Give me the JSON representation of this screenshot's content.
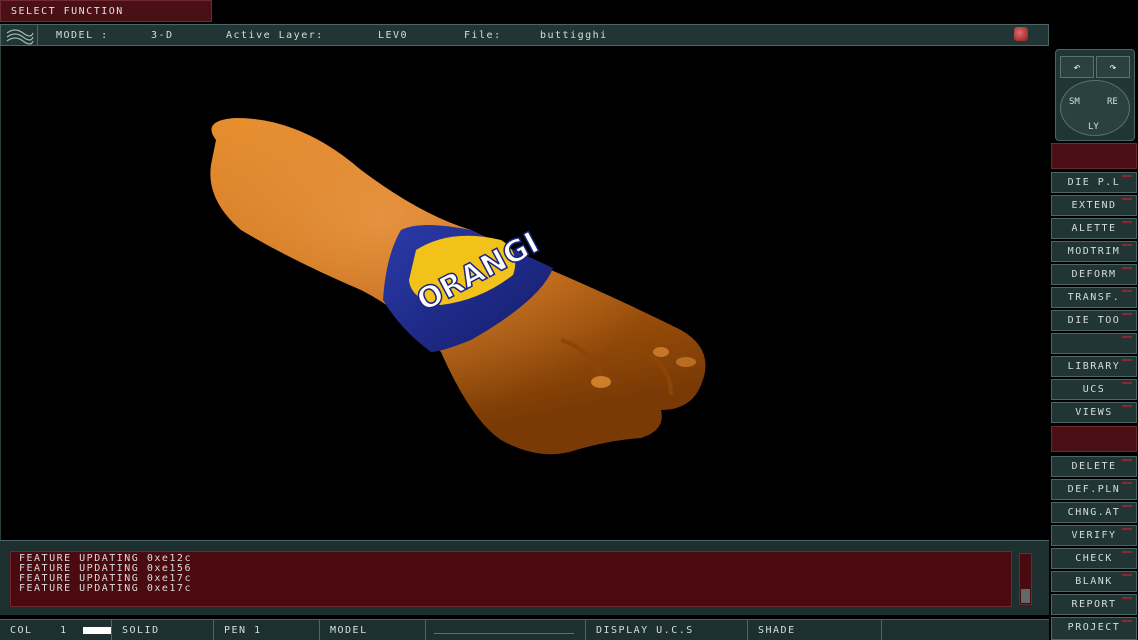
{
  "top": {
    "select_function": "SELECT FUNCTION"
  },
  "header": {
    "model_label": "MODEL :",
    "model_value": "3-D",
    "layer_label": "Active Layer:",
    "layer_value": "LEV0",
    "file_label": "File:",
    "file_value": "buttigghi"
  },
  "viewport": {
    "label_text": "ORANGI"
  },
  "messages": [
    "FEATURE UPDATING 0xe12c",
    "FEATURE UPDATING 0xe156",
    "FEATURE UPDATING 0xe17c",
    "FEATURE UPDATING 0xe17c"
  ],
  "status": {
    "col_label": "COL",
    "col_value": "1",
    "line_style": "SOLID",
    "pen": "PEN 1",
    "mode": "MODEL",
    "display": "DISPLAY U.C.S",
    "shade": "SHADE"
  },
  "dial": {
    "sm": "SM",
    "re": "RE",
    "ly": "LY"
  },
  "menu": {
    "group1": [
      "DIE P.L",
      "EXTEND",
      "ALETTE",
      "MODTRIM",
      "DEFORM",
      "TRANSF.",
      "DIE TOO",
      ""
    ],
    "group2": [
      "LIBRARY",
      "UCS",
      "VIEWS"
    ],
    "group3": [
      "DELETE",
      "DEF.PLN",
      "CHNG.AT",
      "VERIFY",
      "CHECK",
      "BLANK",
      "REPORT",
      "PROJECT"
    ]
  },
  "colors": {
    "panel": "#213534",
    "border": "#4b6664",
    "alert": "#4b1015",
    "bottle": "#c86a0c",
    "label": "#1e2e8a"
  }
}
